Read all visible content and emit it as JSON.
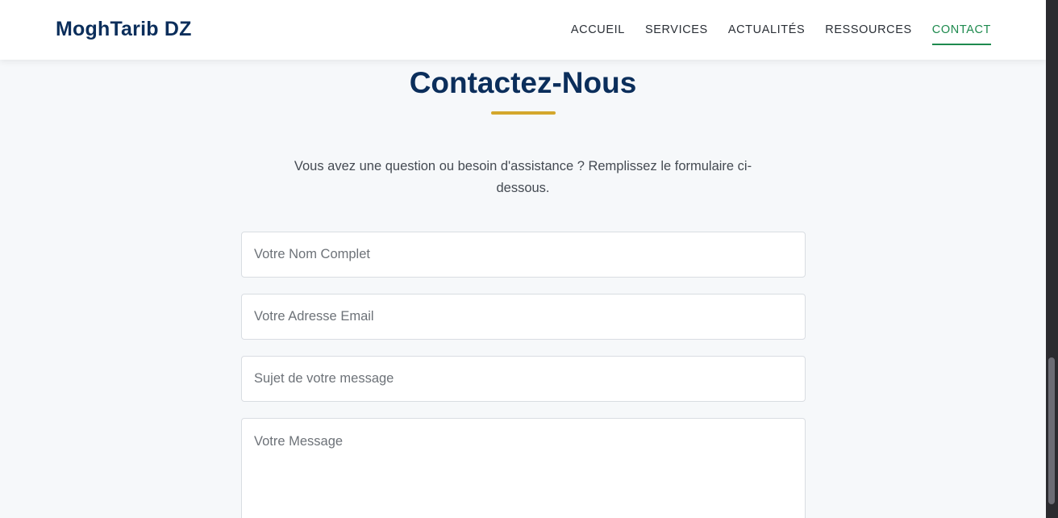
{
  "header": {
    "logo": "MoghTarib DZ",
    "nav": [
      {
        "label": "ACCUEIL",
        "active": false
      },
      {
        "label": "SERVICES",
        "active": false
      },
      {
        "label": "ACTUALITÉS",
        "active": false
      },
      {
        "label": "RESSOURCES",
        "active": false
      },
      {
        "label": "CONTACT",
        "active": true
      }
    ]
  },
  "contact": {
    "title": "Contactez-Nous",
    "intro": "Vous avez une question ou besoin d'assistance ? Remplissez le formulaire ci-dessous.",
    "form": {
      "name_placeholder": "Votre Nom Complet",
      "email_placeholder": "Votre Adresse Email",
      "subject_placeholder": "Sujet de votre message",
      "message_placeholder": "Votre Message"
    }
  },
  "colors": {
    "brand_navy": "#0b2e5b",
    "accent_green": "#1e8a4e",
    "accent_gold": "#d4a72c",
    "background": "#f6f8fa"
  }
}
